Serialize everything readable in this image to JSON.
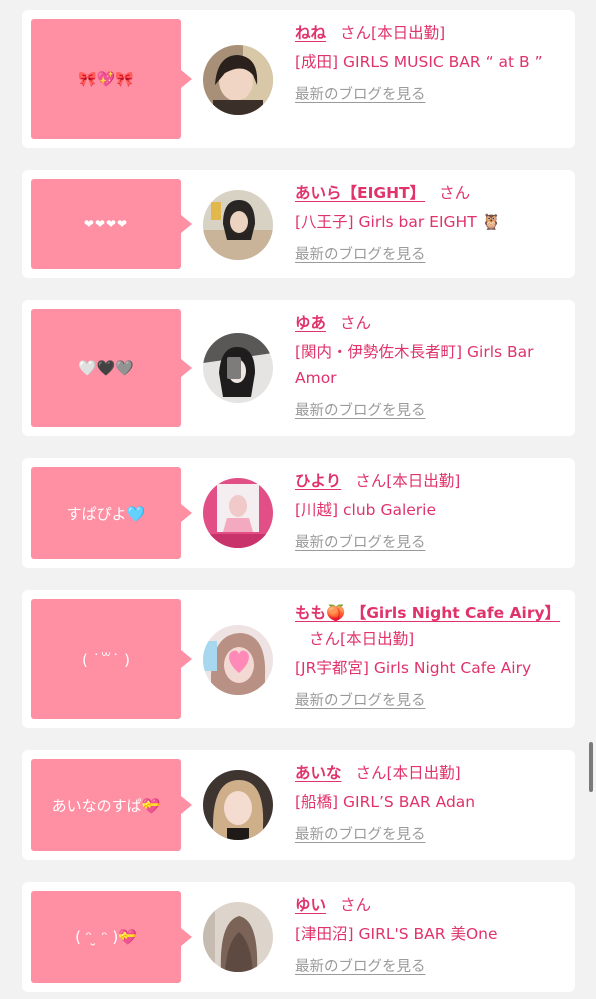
{
  "colors": {
    "accent": "#e0336b",
    "bubble": "#ff8fa3",
    "link_gray": "#9a9a9a"
  },
  "honorific": "さん",
  "blog_link_label": "最新のブログを見る",
  "cards": [
    {
      "bubble": "🎀💖🎀",
      "name": "ねね",
      "status": "[本日出勤]",
      "shop": "[成田] GIRLS MUSIC BAR “ at B ”"
    },
    {
      "bubble": "❤❤❤❤",
      "name": "あいら【EIGHT】",
      "status": "",
      "shop": "[八王子] Girls bar EIGHT 🦉"
    },
    {
      "bubble": "🤍🖤🩶",
      "name": "ゆあ",
      "status": "",
      "shop": "[関内・伊勢佐木長者町] Girls Bar Amor"
    },
    {
      "bubble": "すぱぴよ🩵",
      "name": "ひより",
      "status": "[本日出勤]",
      "shop": "[川越] club Galerie"
    },
    {
      "bubble": "( ˙꒳˙ )",
      "name": "もも🍑 【Girls Night Cafe Airy】",
      "status": "[本日出勤]",
      "shop": "[JR宇都宮] Girls Night Cafe Airy"
    },
    {
      "bubble": "あいなのすぱ💝",
      "name": "あいな",
      "status": "[本日出勤]",
      "shop": "[船橋] GIRL’S BAR Adan"
    },
    {
      "bubble": "( ᵔ ̮ ᵔ )💝",
      "name": "ゆい",
      "status": "",
      "shop": "[津田沼] GIRL'S BAR 美One"
    }
  ]
}
